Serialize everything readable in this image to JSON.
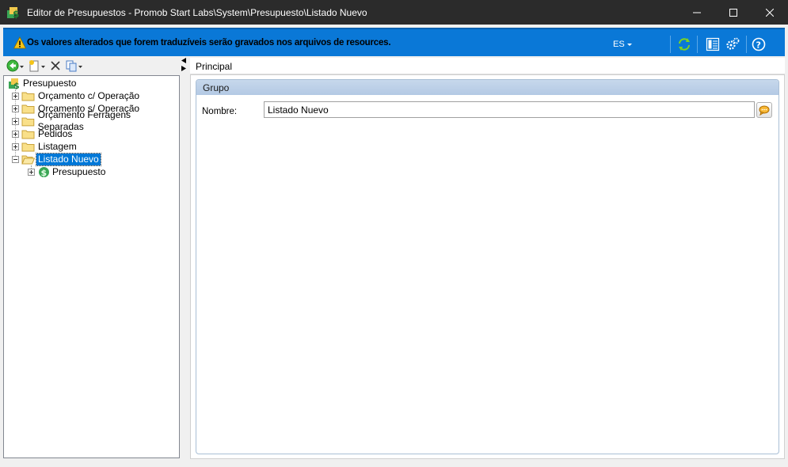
{
  "window": {
    "title": "Editor de Presupuestos - Promob Start Labs\\System\\Presupuesto\\Listado Nuevo",
    "controls": [
      "minimize",
      "maximize",
      "close"
    ]
  },
  "banner": {
    "message": "Os valores alterados que forem traduzíveis serão gravados nos arquivos de resources.",
    "language": "ES",
    "icons": [
      "warning-icon",
      "refresh-icon",
      "layout-icon",
      "settings-icon",
      "help-icon"
    ],
    "colors": {
      "background": "#0a78d7"
    }
  },
  "toolbar": {
    "icons": [
      "back-icon",
      "new-item-icon",
      "delete-icon",
      "copy-icon"
    ]
  },
  "tree": {
    "root": "Presupuesto",
    "items": [
      {
        "label": "Orçamento c/ Operação"
      },
      {
        "label": "Orçamento s/ Operação"
      },
      {
        "label": "Orçamento Ferragens Separadas"
      },
      {
        "label": "Pedidos"
      },
      {
        "label": "Listagem"
      },
      {
        "label": "Listado Nuevo",
        "selected": true,
        "expanded": true
      }
    ],
    "child": "Presupuesto"
  },
  "main": {
    "tab": "Principal",
    "group": "Grupo",
    "name_label": "Nombre:",
    "name_value": "Listado Nuevo"
  }
}
